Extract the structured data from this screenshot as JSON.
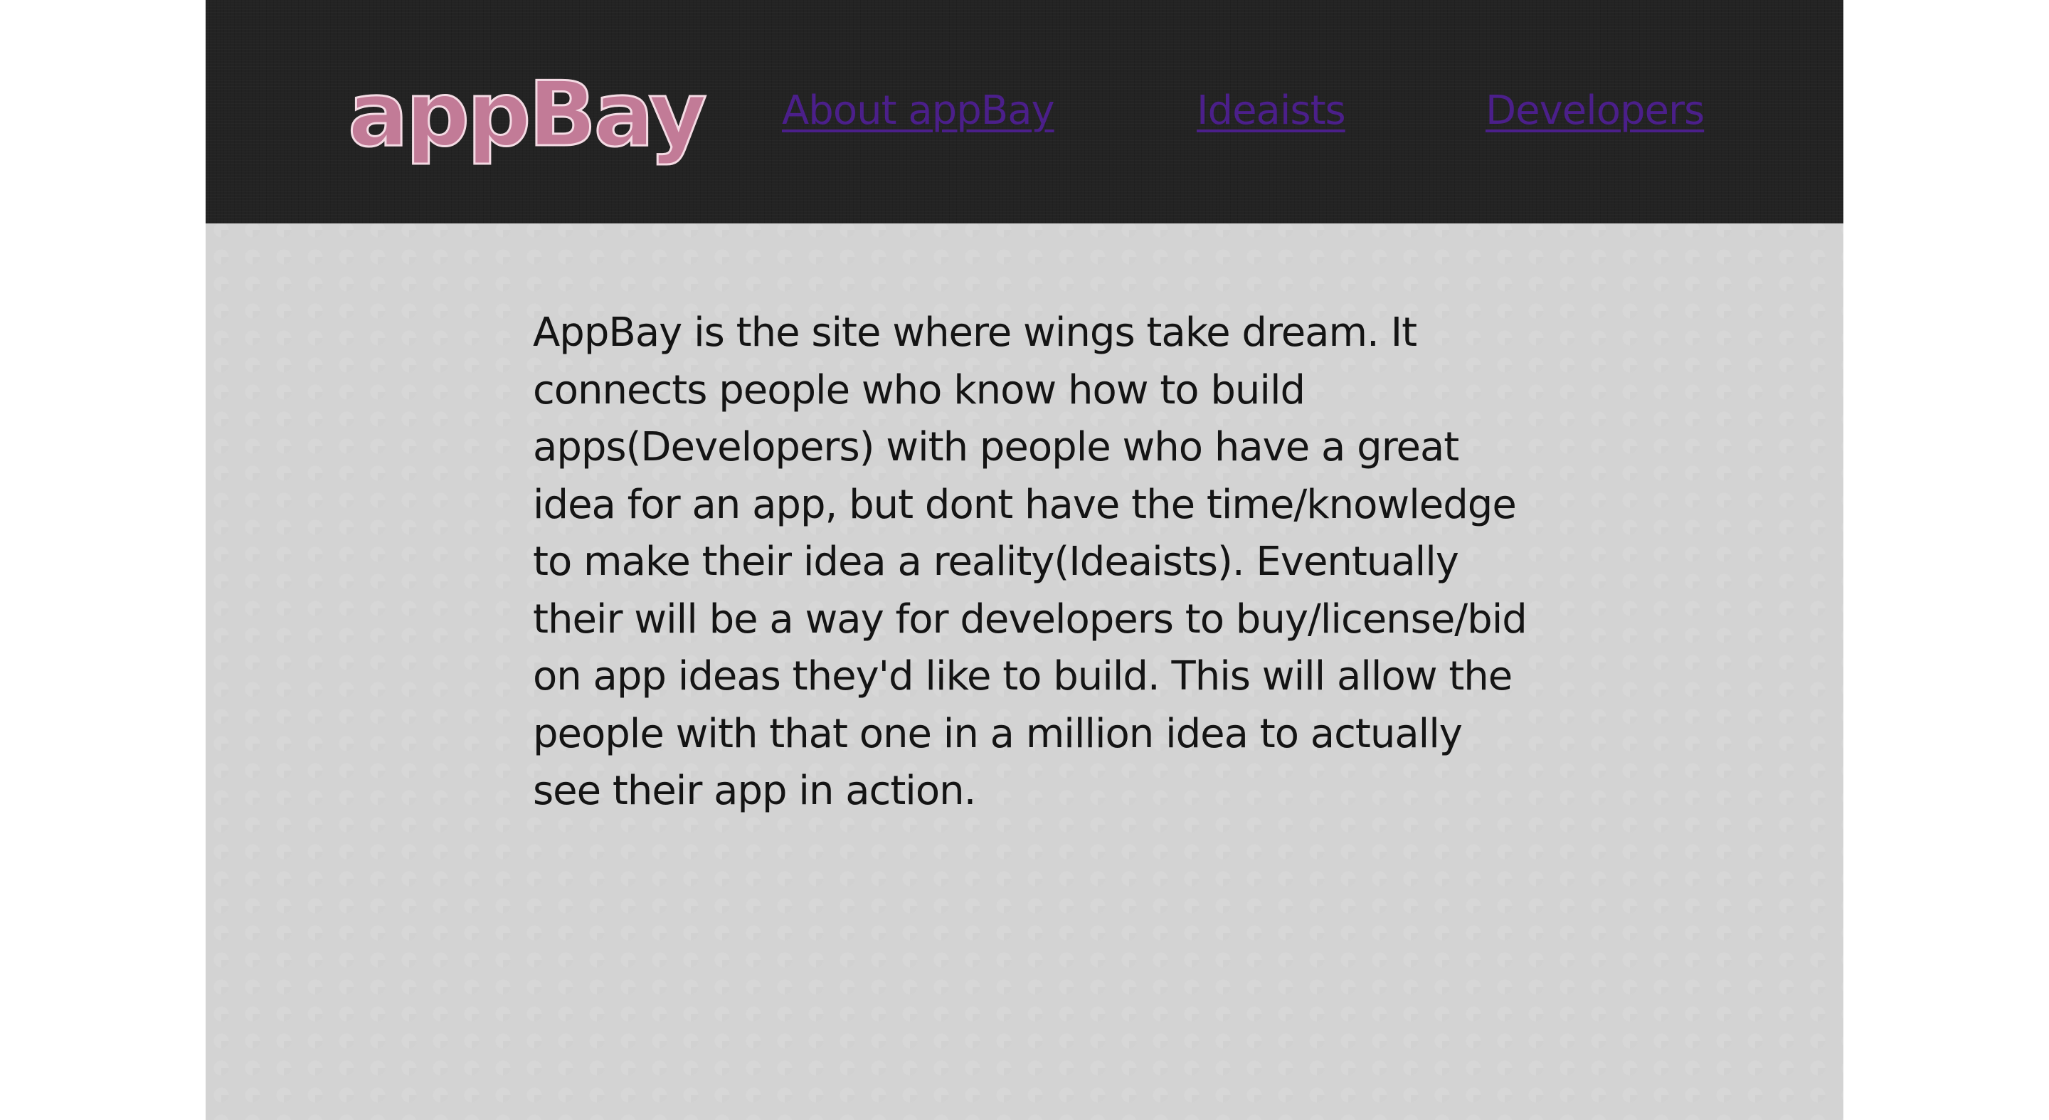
{
  "header": {
    "logo": "appBay",
    "nav": {
      "about": "About appBay",
      "ideaists": "Ideaists",
      "developers": "Developers"
    }
  },
  "main": {
    "intro": "AppBay is the site where wings take dream. It connects people who know how to build apps(Developers) with people who have a great idea for an app, but dont have the time/knowledge to make their idea a reality(Ideaists). Eventually their will be a way for developers to buy/license/bid on app ideas they'd like to build. This will allow the people with that one in a million idea to actually see their app in action."
  },
  "colors": {
    "header_background": "#232323",
    "page_background": "#d3d3d3",
    "logo": "#c27b97",
    "link": "#4b1f8a",
    "text": "#141414"
  }
}
